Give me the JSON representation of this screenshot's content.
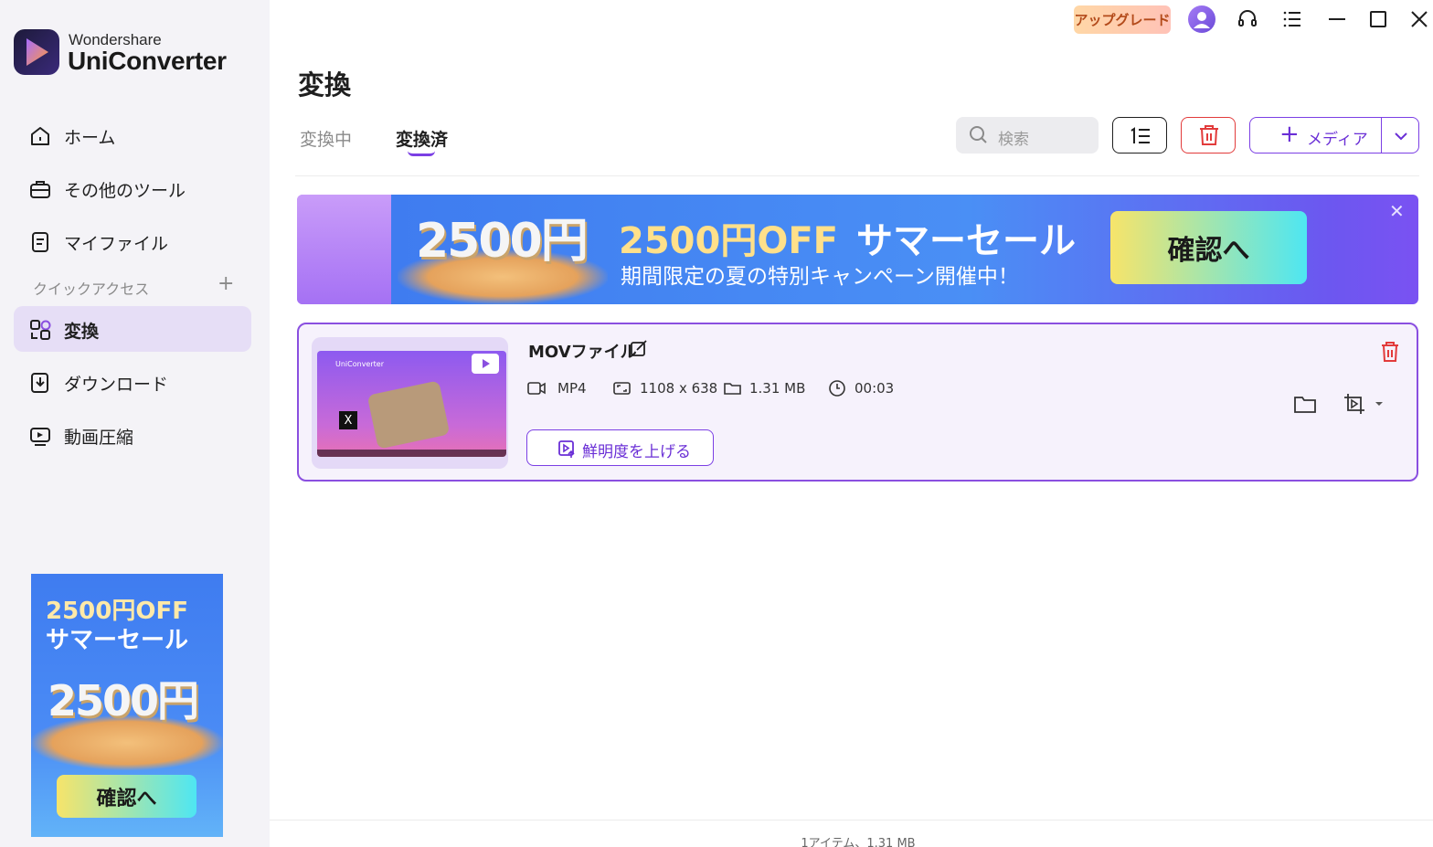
{
  "app": {
    "brand_top": "Wondershare",
    "brand_main": "UniConverter"
  },
  "titlebar": {
    "upgrade_label": "アップグレード",
    "icons": [
      "avatar-icon",
      "headset-icon",
      "menu-icon",
      "minimize-icon",
      "maximize-icon",
      "close-icon"
    ]
  },
  "sidebar": {
    "items": [
      {
        "label": "ホーム",
        "icon": "home-icon"
      },
      {
        "label": "その他のツール",
        "icon": "toolbox-icon"
      },
      {
        "label": "マイファイル",
        "icon": "file-icon"
      },
      {
        "label": "変換",
        "icon": "convert-icon",
        "active": true
      },
      {
        "label": "ダウンロード",
        "icon": "download-icon"
      },
      {
        "label": "動画圧縮",
        "icon": "compress-icon"
      }
    ],
    "quick_access_label": "クイックアクセス",
    "quick_access_add": "+",
    "ad": {
      "line1": "2500円OFF",
      "line2": "サマーセール",
      "big": "2500円",
      "cta": "確認へ"
    }
  },
  "main": {
    "title": "変換",
    "tabs": [
      {
        "label": "変換中",
        "active": false
      },
      {
        "label": "変換済",
        "active": true
      }
    ],
    "search_placeholder": "検索",
    "add_media_label": "メディア",
    "add_media_plus": "+"
  },
  "banner": {
    "big": "2500円",
    "headline_a": "2500円OFF",
    "headline_b": "サマーセール",
    "subline": "期間限定の夏の特別キャンペーン開催中！",
    "cta": "確認へ",
    "close": "✕"
  },
  "file": {
    "name": "MOVファイル",
    "format": "MP4",
    "resolution": "1108 x 638",
    "size": "1.31 MB",
    "duration": "00:03",
    "enhance_label": "鮮明度を上げる",
    "thumb_title": "UniConverter",
    "thumb_badge": "X"
  },
  "status": {
    "text": "1アイテム、1.31 MB"
  },
  "colors": {
    "accent": "#7b3fe4",
    "danger": "#e23b3b",
    "sidebar_bg": "#f4f3f7",
    "active_nav": "#e6def6"
  }
}
